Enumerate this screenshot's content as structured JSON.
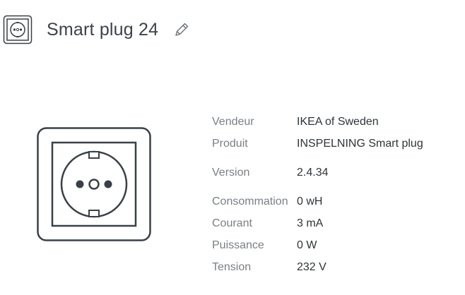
{
  "header": {
    "title": "Smart plug 24",
    "device_icon": "wall-outlet-icon",
    "edit_icon": "pencil-icon"
  },
  "device": {
    "image_icon": "wall-outlet-icon"
  },
  "info": {
    "vendor": {
      "label": "Vendeur",
      "value": "IKEA of Sweden"
    },
    "product": {
      "label": "Produit",
      "value": "INSPELNING Smart plug"
    },
    "version": {
      "label": "Version",
      "value": "2.4.34"
    },
    "consumption": {
      "label": "Consommation",
      "value": "0 wH"
    },
    "current": {
      "label": "Courant",
      "value": "3 mA"
    },
    "power": {
      "label": "Puissance",
      "value": "0 W"
    },
    "voltage": {
      "label": "Tension",
      "value": "232 V"
    }
  },
  "colors": {
    "icon_stroke": "#3a4047",
    "label_text": "#7a7f85",
    "value_text": "#2f3439"
  }
}
